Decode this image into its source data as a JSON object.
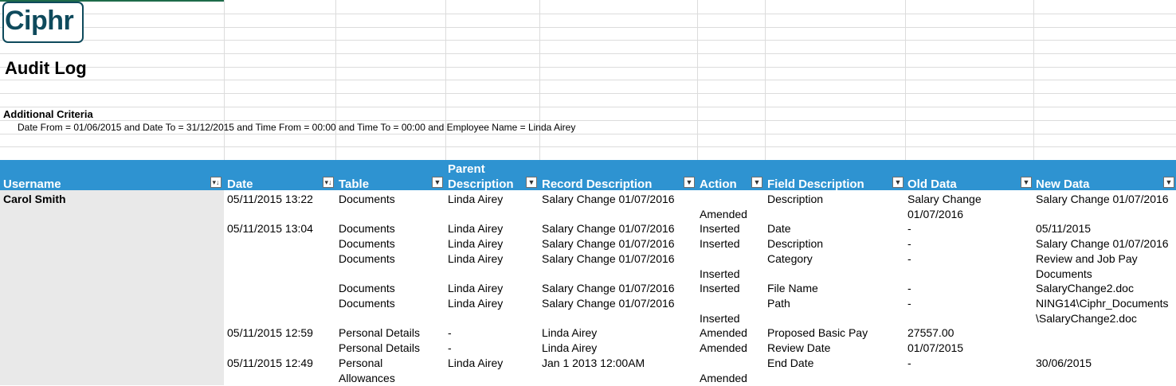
{
  "logo": {
    "text": "Ciphr"
  },
  "title": "Audit Log",
  "criteria": {
    "label": "Additional Criteria",
    "text": "Date From = 01/06/2015 and Date To = 31/12/2015 and Time From = 00:00 and Time To = 00:00 and Employee Name = Linda Airey"
  },
  "columns": {
    "username": "Username",
    "date": "Date",
    "table": "Table",
    "parent_1": "Parent",
    "parent_2": "Description",
    "record": "Record Description",
    "action": "Action",
    "field": "Field Description",
    "old": "Old Data",
    "new": "New Data"
  },
  "filter_icons": {
    "sorted": "sort-filter-icon",
    "dropdown": "filter-dropdown-icon"
  },
  "colors": {
    "header_bg": "#2e93d1",
    "logo": "#0e4a5c",
    "username_bg": "#e9e9e9"
  },
  "username": "Carol Smith",
  "rows": [
    {
      "date": "05/11/2015 13:22",
      "table": "Documents",
      "parent": "Linda Airey",
      "record": "Salary Change 01/07/2016",
      "action": "Amended",
      "field": "Description",
      "old": "Salary Change",
      "old2": "01/07/2016",
      "new": "Salary Change 01/07/2016"
    },
    {
      "date": "05/11/2015 13:04",
      "table": "Documents",
      "parent": "Linda Airey",
      "record": "Salary Change 01/07/2016",
      "action": "Inserted",
      "field": "Date",
      "old": "-",
      "new": "05/11/2015"
    },
    {
      "table": "Documents",
      "parent": "Linda Airey",
      "record": "Salary Change 01/07/2016",
      "action": "Inserted",
      "field": "Description",
      "old": "-",
      "new": "Salary Change 01/07/2016"
    },
    {
      "table": "Documents",
      "parent": "Linda Airey",
      "record": "Salary Change 01/07/2016",
      "action": "Inserted",
      "field": "Category",
      "old": "-",
      "new": "Review and Job Pay",
      "new2": "Documents"
    },
    {
      "table": "Documents",
      "parent": "Linda Airey",
      "record": "Salary Change 01/07/2016",
      "action": "Inserted",
      "field": "File Name",
      "old": "-",
      "new": "SalaryChange2.doc"
    },
    {
      "table": "Documents",
      "parent": "Linda Airey",
      "record": "Salary Change 01/07/2016",
      "action": "Inserted",
      "field": "Path",
      "old": "-",
      "new": "NING14\\Ciphr_Documents",
      "new2": "\\SalaryChange2.doc"
    },
    {
      "date": "05/11/2015 12:59",
      "table": "Personal Details",
      "parent": "-",
      "record": "Linda Airey",
      "action": "Amended",
      "field": "Proposed Basic Pay",
      "old": "27557.00",
      "new": ""
    },
    {
      "table": "Personal Details",
      "parent": "-",
      "record": "Linda Airey",
      "action": "Amended",
      "field": "Review Date",
      "old": "01/07/2015",
      "new": ""
    },
    {
      "date": "05/11/2015 12:49",
      "table": "Personal",
      "table2": "Allowances",
      "parent": "Linda Airey",
      "record": "Jan  1 2013 12:00AM",
      "action": "Amended",
      "field": "End Date",
      "old": "-",
      "new": "30/06/2015"
    }
  ]
}
